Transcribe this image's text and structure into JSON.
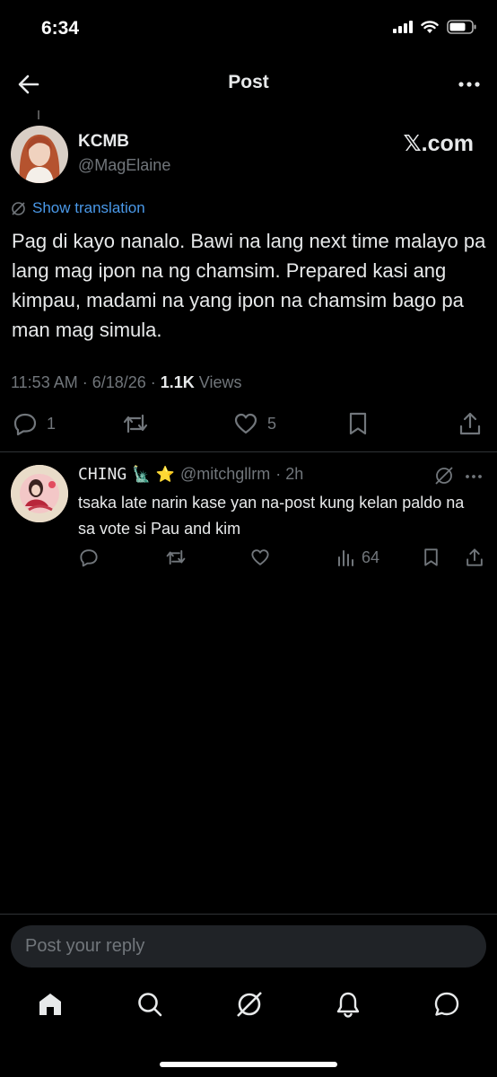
{
  "status_bar": {
    "time": "6:34"
  },
  "header": {
    "title": "Post"
  },
  "post": {
    "author_name": "KCMB",
    "author_handle": "@MagElaine",
    "source_watermark": "𝕏.com",
    "translation_label": "Show translation",
    "text": "Pag di kayo nanalo. Bawi na lang next time malayo pa lang mag ipon na ng chamsim. Prepared kasi ang kimpau, madami na yang ipon na chamsim bago pa man mag simula.",
    "timestamp": "11:53 AM · 6/18/26 · ",
    "views_count": "1.1K",
    "views_label": " Views",
    "reply_count": "1",
    "like_count": "5"
  },
  "reply": {
    "author_name": "CHING",
    "author_emoji": "🗽 ⭐️",
    "author_handle": "@mitchgllrm",
    "time": "· 2h",
    "text": "tsaka late narin kase yan na-post kung kelan paldo na sa vote si Pau and kim",
    "views_count": "64"
  },
  "composer": {
    "placeholder": "Post your reply"
  },
  "colors": {
    "background": "#000000",
    "text": "#e7e9ea",
    "muted": "#71767b",
    "link": "#4a99e9"
  },
  "icons": {
    "tabbar": [
      "home-icon",
      "search-icon",
      "grok-icon",
      "notifications-icon",
      "messages-icon"
    ]
  }
}
